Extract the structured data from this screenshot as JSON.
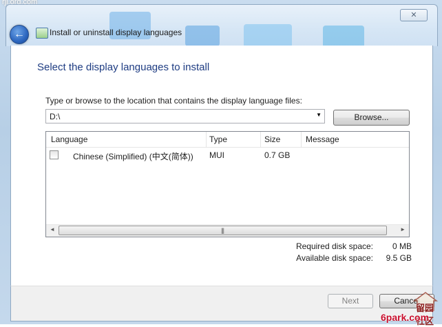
{
  "watermark_top": "rji.org.com",
  "window": {
    "title": "Install or uninstall display languages",
    "close_glyph": "✕",
    "back_glyph": "←"
  },
  "heading": "Select the display languages to install",
  "location": {
    "label": "Type or browse to the location that contains the display language files:",
    "value": "D:\\",
    "browse_label": "Browse..."
  },
  "table": {
    "columns": [
      "Language",
      "Type",
      "Size",
      "Message"
    ],
    "rows": [
      {
        "language": "Chinese (Simplified) (中文(简体))",
        "type": "MUI",
        "size": "0.7 GB",
        "message": "",
        "checked": false
      }
    ]
  },
  "disk": {
    "required_label": "Required disk space:",
    "required_value": "0 MB",
    "available_label": "Available disk space:",
    "available_value": "9.5 GB"
  },
  "buttons": {
    "next_label": "Next",
    "cancel_label": "Cancel"
  },
  "watermarks": {
    "logo_text": "留园社区",
    "site_text": "6park.com"
  },
  "colors": {
    "heading": "#1e3c82",
    "frame": "#b7cfe6"
  }
}
